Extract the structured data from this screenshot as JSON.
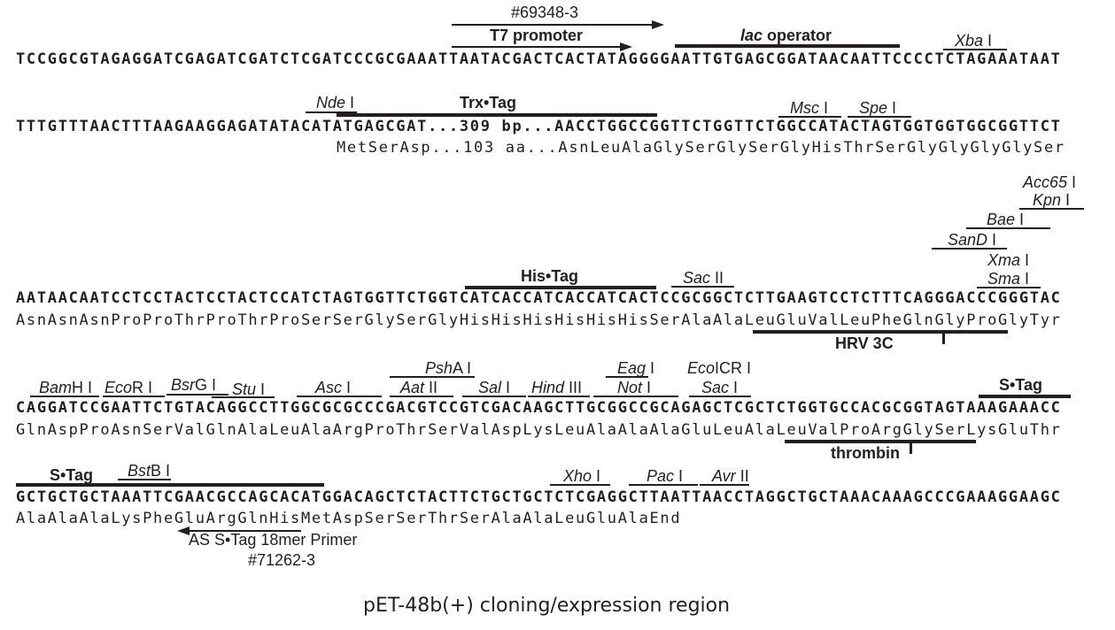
{
  "title": "pET-48b(+) cloning/expression region",
  "lines": [
    {
      "dna": "TCCGGCGTAGAGGATCGAGATCGATCTCGATCCCGCGAAATTAATACGACTCACTATAGGGGAATTGTGAGCGGATAACAATTCCCCTCTAGAAATAAT"
    },
    {
      "dna": "TTTGTTTAACTTTAAGAAGGAGATATACATATGAGCGAT...309 bp...AACCTGGCCGGTTCTGGTTCTGGCCATACTAGTGGTGGTGGCGGTTCT",
      "protein": "MetSerAsp...103 aa...AsnLeuAlaGlySerGlySerGlyHisThrSerGlyGlyGlyGlySer"
    },
    {
      "dna": "AATAACAATCCTCCTACTCCTACTCCATCTAGTGGTTCTGGTCATCACCATCACCATCACTCCGCGGCTCTTGAAGTCCTCTTTCAGGGACCCGGGTAC",
      "protein": "AsnAsnAsnProProThrProThrProSerSerGlySerGlyHisHisHisHisHisHisSerAlaAlaLeuGluValLeuPheGlnGlyProGlyTyr"
    },
    {
      "dna": "CAGGATCCGAATTCTGTACAGGCCTTGGCGCGCCCGACGTCCGTCGACAAGCTTGCGGCCGCAGAGCTCGCTCTGGTGCCACGCGGTAGTAAAGAAACC",
      "protein": "GlnAspProAsnSerValGlnAlaLeuAlaArgProThrSerValAspLysLeuAlaAlaAlaGluLeuAlaLeuValProArgGlySerLysGluThr"
    },
    {
      "dna": "GCTGCTGCTAAATTCGAACGCCAGCACATGGACAGCTCTACTTCTGCTGCTCTCGAGGCTTAATTAACCTAGGCTGCTAAACAAAGCCCGAAAGGAAGC",
      "protein": "AlaAlaAlaLysPheGluArgGlnHisMetAspSerSerThrSerAlaAlaLeuGluAlaEnd"
    }
  ],
  "features": {
    "primer_fwd_id": "#69348-3",
    "t7_promoter": "T7 promoter",
    "lac_operator_italic": "lac",
    "lac_operator_rest": " operator",
    "trx_tag": "Trx•Tag",
    "his_tag": "His•Tag",
    "hrv3c": "HRV 3C",
    "thrombin": "thrombin",
    "s_tag_1": "S•Tag",
    "s_tag_2": "S•Tag",
    "primer_rev": "AS S•Tag 18mer Primer",
    "primer_rev_id": "#71262-3"
  },
  "sites": {
    "xba": [
      "Xba",
      " I"
    ],
    "nde": [
      "Nde",
      " I"
    ],
    "msc": [
      "Msc",
      " I"
    ],
    "spe": [
      "Spe",
      " I"
    ],
    "acc65": [
      "Acc65",
      " I"
    ],
    "kpn": [
      "Kpn",
      " I"
    ],
    "bae": [
      "Bae",
      " I"
    ],
    "sand": [
      "SanD",
      " I"
    ],
    "xma": [
      "Xma",
      " I"
    ],
    "sma": [
      "Sma",
      " I"
    ],
    "sac2": [
      "Sac",
      " II"
    ],
    "bamh": [
      "Bam",
      "H I"
    ],
    "ecor": [
      "Eco",
      "R I"
    ],
    "bsrg": [
      "Bsr",
      "G I"
    ],
    "stu": [
      "Stu",
      " I"
    ],
    "asc": [
      "Asc",
      " I"
    ],
    "psha": [
      "Psh",
      "A I"
    ],
    "aat2": [
      "Aat",
      " II"
    ],
    "sal": [
      "Sal",
      " I"
    ],
    "hind3": [
      "Hind",
      " III"
    ],
    "eag": [
      "Eag",
      " I"
    ],
    "not": [
      "Not",
      " I"
    ],
    "ecoicr": [
      "Eco",
      "ICR I"
    ],
    "sac": [
      "Sac",
      " I"
    ],
    "bstb": [
      "Bst",
      "B I"
    ],
    "xho": [
      "Xho",
      " I"
    ],
    "pac": [
      "Pac",
      " I"
    ],
    "avr2": [
      "Avr",
      " II"
    ]
  }
}
